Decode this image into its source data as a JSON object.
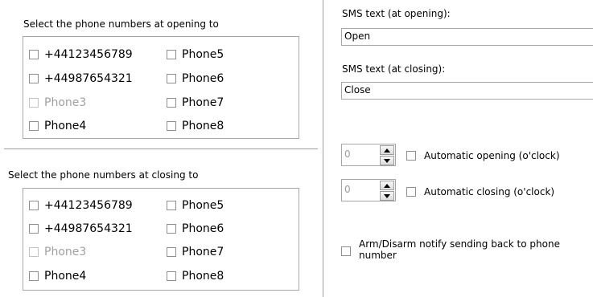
{
  "opening": {
    "title": "Select the phone numbers at opening to",
    "items": [
      {
        "label": "+44123456789",
        "disabled": false
      },
      {
        "label": "+44987654321",
        "disabled": false
      },
      {
        "label": "Phone3",
        "disabled": true
      },
      {
        "label": "Phone4",
        "disabled": false
      },
      {
        "label": "Phone5",
        "disabled": false
      },
      {
        "label": "Phone6",
        "disabled": false
      },
      {
        "label": "Phone7",
        "disabled": false
      },
      {
        "label": "Phone8",
        "disabled": false
      }
    ]
  },
  "closing": {
    "title": "Select the phone numbers at closing to",
    "items": [
      {
        "label": "+44123456789",
        "disabled": false
      },
      {
        "label": "+44987654321",
        "disabled": false
      },
      {
        "label": "Phone3",
        "disabled": true
      },
      {
        "label": "Phone4",
        "disabled": false
      },
      {
        "label": "Phone5",
        "disabled": false
      },
      {
        "label": "Phone6",
        "disabled": false
      },
      {
        "label": "Phone7",
        "disabled": false
      },
      {
        "label": "Phone8",
        "disabled": false
      }
    ]
  },
  "sms": {
    "opening_label": "SMS text (at opening):",
    "opening_value": "Open",
    "closing_label": "SMS text (at closing):",
    "closing_value": "Close"
  },
  "auto": {
    "opening_value": "0",
    "opening_label": "Automatic opening (o'clock)",
    "closing_value": "0",
    "closing_label": "Automatic closing (o'clock)"
  },
  "notify": {
    "label_line1": "Arm/Disarm notify sending back to phone",
    "label_line2": "number"
  },
  "colors": {
    "disabled_text": "#a0a0a0",
    "border": "#a6a6a6"
  }
}
